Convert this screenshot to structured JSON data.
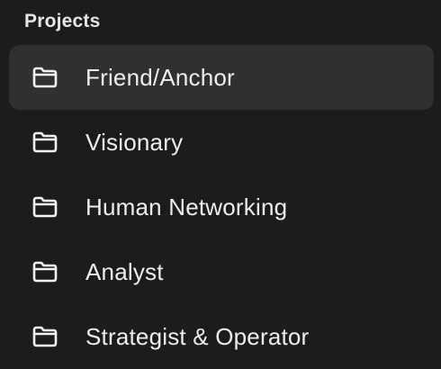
{
  "sidebar": {
    "section_title": "Projects",
    "items": [
      {
        "label": "Friend/Anchor",
        "icon": "folder-icon",
        "selected": true
      },
      {
        "label": "Visionary",
        "icon": "folder-icon",
        "selected": false
      },
      {
        "label": "Human Networking",
        "icon": "folder-icon",
        "selected": false
      },
      {
        "label": "Analyst",
        "icon": "folder-icon",
        "selected": false
      },
      {
        "label": "Strategist & Operator",
        "icon": "folder-icon",
        "selected": false
      }
    ]
  },
  "colors": {
    "background": "#1c1c1c",
    "selected_background": "#303030",
    "text": "#ededed",
    "icon": "#f2f2f2"
  }
}
